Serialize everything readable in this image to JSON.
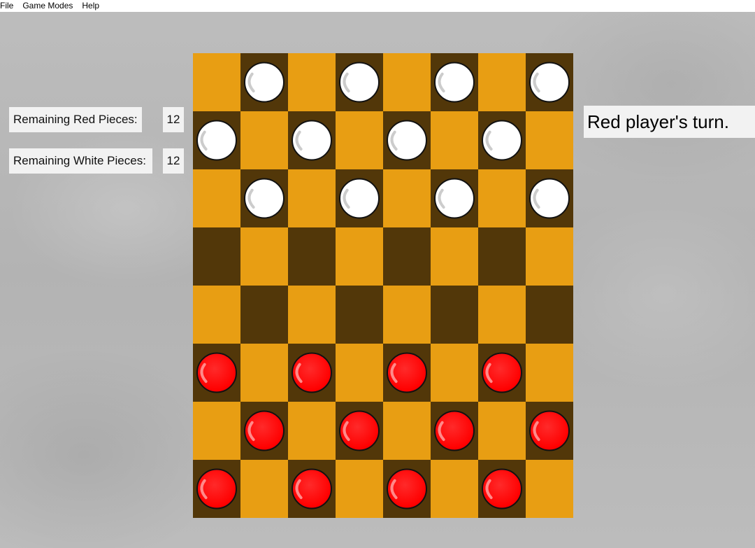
{
  "menu": {
    "items": [
      "File",
      "Game Modes",
      "Help"
    ]
  },
  "stats": {
    "red_label": "Remaining Red Pieces:",
    "red_count": "12",
    "white_label": "Remaining White Pieces:",
    "white_count": "12"
  },
  "status": {
    "turn_text": "Red player's turn."
  },
  "colors": {
    "light_square": "#e89e13",
    "dark_square": "#523709",
    "red_piece": "#ff0000",
    "white_piece": "#ffffff",
    "piece_outline": "#111111"
  },
  "board": {
    "rows": 8,
    "cols": 8,
    "state": [
      ".w.w.w.w",
      "w.w.w.w.",
      ".w.w.w.w",
      "........",
      "........",
      "r.r.r.r.",
      ".r.r.r.r",
      "r.r.r.r."
    ]
  }
}
